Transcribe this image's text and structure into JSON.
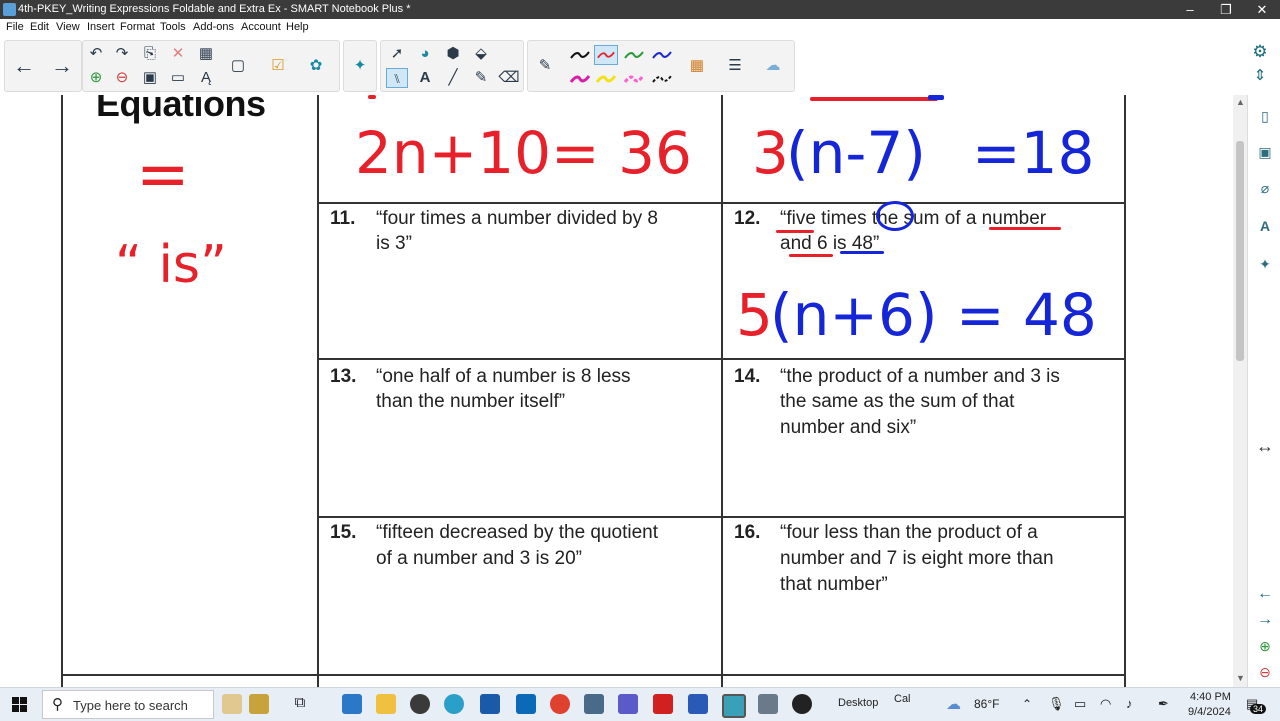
{
  "window": {
    "title": "4th-PKEY_Writing Expressions Foldable and Extra Ex - SMART Notebook Plus *",
    "controls": [
      "–",
      "❐",
      "✕"
    ]
  },
  "menu": [
    "File",
    "Edit",
    "View",
    "Insert",
    "Format",
    "Tools",
    "Add-ons",
    "Account",
    "Help"
  ],
  "toolbar": {
    "groups": [
      "navigation",
      "edit",
      "select-tools",
      "pens",
      "extras"
    ],
    "pen_colors": {
      "black": "#111111",
      "red": "#e8202a",
      "green": "#2a9a3a",
      "blue": "#1b2bd0",
      "magenta": "#d81fa8",
      "yellow": "#f2e21a",
      "pink": "#ff5fd2"
    }
  },
  "worksheet": {
    "left_heading": "Equations",
    "problems": [
      {
        "num": "11.",
        "line1": "“four times a number divided by 8",
        "line2": "is 3”",
        "line3": ""
      },
      {
        "num": "12.",
        "line1": "“five times the sum of a number",
        "line2": "and 6 is 48”",
        "line3": ""
      },
      {
        "num": "13.",
        "line1": "“one half of a number is 8 less",
        "line2": "than the number itself”",
        "line3": ""
      },
      {
        "num": "14.",
        "line1": "“the product of a number and 3 is",
        "line2": "the same as the sum of that",
        "line3": "number and six”"
      },
      {
        "num": "15.",
        "line1": "“fifteen decreased by the quotient",
        "line2": "of a number and 3 is 20”",
        "line3": ""
      },
      {
        "num": "16.",
        "line1": "“four less than the product of a",
        "line2": "number and 7 is eight more than",
        "line3": "that number”"
      }
    ]
  },
  "ink": {
    "equals_sign": "=",
    "is_word": "“ is”",
    "eq_top_left": "2n+10= 36",
    "eq_top_right_a": "3",
    "eq_top_right_b": "(n-7)",
    "eq_top_right_c": "=18",
    "eq_12_a": "5",
    "eq_12_b": "(n+6)",
    "eq_12_c": "= 48",
    "colors": {
      "red": "#e8202a",
      "blue": "#1525d8"
    }
  },
  "sidebar": [
    "page-sorter",
    "gallery",
    "attachments",
    "properties",
    "add-ons",
    "resize"
  ],
  "taskbar": {
    "search_placeholder": "Type here to search",
    "desktop_label": "Desktop",
    "cal_label": "Cal",
    "weather": "86°F",
    "time": "4:40 PM",
    "date": "9/4/2024",
    "notifications": "34"
  }
}
